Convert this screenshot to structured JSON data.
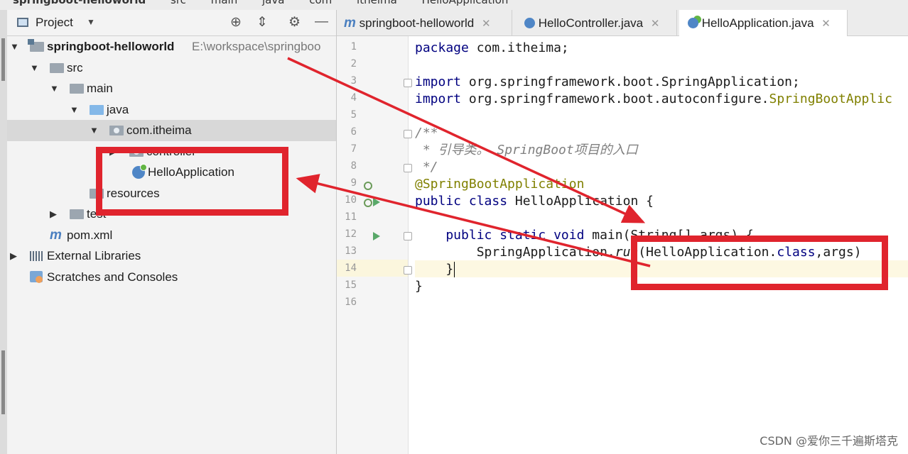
{
  "breadcrumb": [
    "springboot-helloworld",
    "src",
    "main",
    "java",
    "com",
    "itheima",
    "HelloApplication"
  ],
  "project_panel": {
    "title": "Project",
    "tree": [
      {
        "label": "springboot-helloworld",
        "extra": "E:\\workspace\\springboo",
        "icon": "module-folder-icon"
      },
      {
        "label": "src",
        "icon": "folder-icon"
      },
      {
        "label": "main",
        "icon": "folder-icon"
      },
      {
        "label": "java",
        "icon": "source-folder-icon"
      },
      {
        "label": "com.itheima",
        "icon": "package-icon"
      },
      {
        "label": "controller",
        "icon": "package-icon"
      },
      {
        "label": "HelloApplication",
        "icon": "spring-class-icon"
      },
      {
        "label": "resources",
        "icon": "resources-folder-icon"
      },
      {
        "label": "test",
        "icon": "folder-icon"
      },
      {
        "label": "pom.xml",
        "icon": "maven-icon"
      },
      {
        "label": "External Libraries",
        "icon": "libraries-icon"
      },
      {
        "label": "Scratches and Consoles",
        "icon": "scratches-icon"
      }
    ]
  },
  "tabs": [
    {
      "label": "springboot-helloworld",
      "icon": "maven-icon"
    },
    {
      "label": "HelloController.java",
      "icon": "class-icon"
    },
    {
      "label": "HelloApplication.java",
      "icon": "spring-class-icon",
      "active": true
    }
  ],
  "line_numbers": [
    "1",
    "2",
    "3",
    "4",
    "5",
    "6",
    "7",
    "8",
    "9",
    "10",
    "11",
    "12",
    "13",
    "14",
    "15",
    "16"
  ],
  "code": {
    "l1a": "package",
    "l1b": " com.itheima;",
    "l3a": "import",
    "l3b": " org.springframework.boot.SpringApplication;",
    "l4a": "import",
    "l4b": " org.springframework.boot.autoconfigure.",
    "l4c": "SpringBootApplic",
    "l6": "/**",
    "l7a": " * 引导类。 ",
    "l7b": "SpringBoot",
    "l7c": "项目的入口",
    "l8": " */",
    "l9": "@SpringBootApplication",
    "l10a": "public class",
    "l10b": " HelloApplication {",
    "l12a": "    public static void",
    "l12b": " main(String[] args) {",
    "l13a": "        SpringApplication.",
    "l13b": "run",
    "l13c": "(HelloApplication.",
    "l13d": "class",
    "l13e": ",args)",
    "l14": "    }",
    "l15": "}"
  },
  "watermark": "CSDN @爱你三千遍斯塔克"
}
